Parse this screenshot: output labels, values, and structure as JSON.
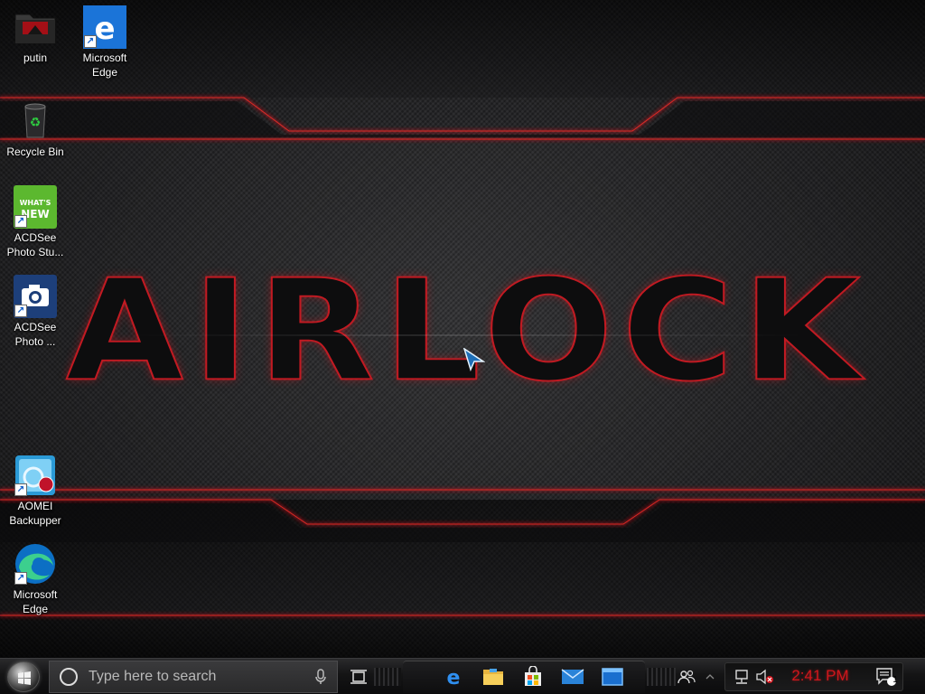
{
  "desktop": {
    "wallpaper_logo": "AIRLOCK",
    "accent_color": "#d0141c",
    "icons": [
      {
        "label": "putin",
        "icon": "folder-icon"
      },
      {
        "label": "Microsoft Edge",
        "icon": "edge-legacy-icon"
      },
      {
        "label": "Recycle Bin",
        "icon": "recycle-bin-icon"
      },
      {
        "label": "ACDSee Photo Stu...",
        "icon": "acdsee-whats-new-icon",
        "badge": "WHAT'S NEW"
      },
      {
        "label": "ACDSee Photo ...",
        "icon": "acdsee-camera-icon"
      },
      {
        "label": "AOMEI Backupper",
        "icon": "aomei-backupper-icon"
      },
      {
        "label": "Microsoft Edge",
        "icon": "edge-chromium-icon"
      }
    ]
  },
  "taskbar": {
    "search_placeholder": "Type here to search",
    "pinned": [
      {
        "name": "Microsoft Edge",
        "icon": "edge-icon"
      },
      {
        "name": "File Explorer",
        "icon": "folder-icon"
      },
      {
        "name": "Microsoft Store",
        "icon": "store-icon"
      },
      {
        "name": "Mail",
        "icon": "mail-icon"
      },
      {
        "name": "Window",
        "icon": "window-icon"
      }
    ],
    "clock": "2:41 PM",
    "notification_count": "1"
  }
}
